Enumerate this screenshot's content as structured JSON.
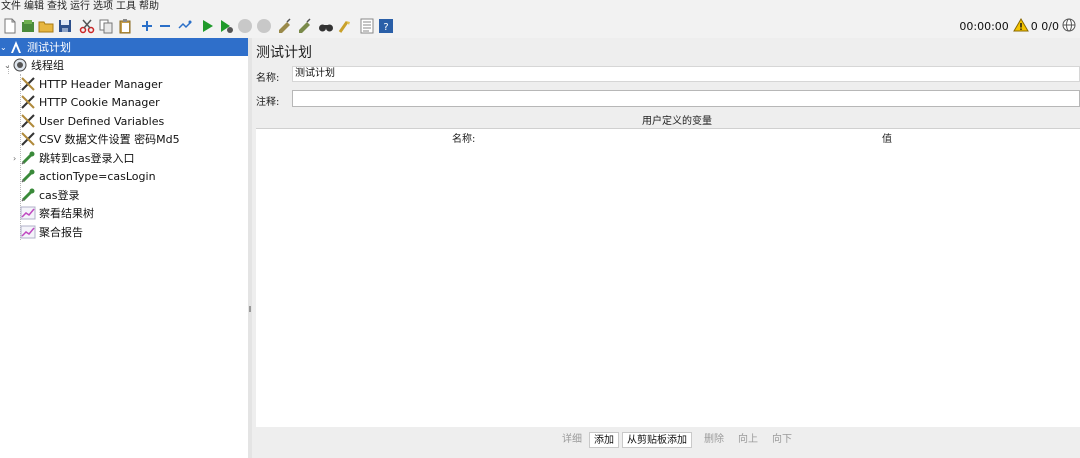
{
  "menu": [
    "文件",
    "编辑",
    "查找",
    "运行",
    "选项",
    "工具",
    "帮助"
  ],
  "toolbar": {
    "icons": [
      "new-icon",
      "templates-icon",
      "open-icon",
      "save-icon",
      "cut-icon",
      "copy-icon",
      "paste-icon",
      "expand-icon",
      "collapse-icon",
      "toggle-icon",
      "start-icon",
      "start-no-pause-icon",
      "stop-icon",
      "shutdown-icon",
      "clear-icon",
      "clear-all-icon",
      "search-icon",
      "reset-search-icon",
      "function-helper-icon",
      "help-icon"
    ]
  },
  "status": {
    "timer": "00:00:00",
    "count": "0 0/0"
  },
  "tree": {
    "items": [
      {
        "label": "测试计划",
        "icon": "test-plan-icon"
      },
      {
        "label": "线程组",
        "icon": "thread-group-icon"
      },
      {
        "label": "HTTP Header Manager",
        "icon": "config-element-icon"
      },
      {
        "label": "HTTP Cookie Manager",
        "icon": "config-element-icon"
      },
      {
        "label": "User Defined Variables",
        "icon": "config-element-icon"
      },
      {
        "label": "CSV 数据文件设置 密码Md5",
        "icon": "config-element-icon"
      },
      {
        "label": "跳转到cas登录入口",
        "icon": "sampler-pipette-icon"
      },
      {
        "label": "actionType=casLogin",
        "icon": "sampler-pipette-icon"
      },
      {
        "label": "cas登录",
        "icon": "sampler-pipette-icon"
      },
      {
        "label": "察看结果树",
        "icon": "listener-chart-icon"
      },
      {
        "label": "聚合报告",
        "icon": "listener-chart-icon"
      }
    ]
  },
  "panel": {
    "title": "测试计划",
    "name_label": "名称:",
    "name_value": "测试计划",
    "comment_label": "注释:",
    "comment_value": "",
    "vars_title": "用户定义的变量",
    "col_name": "名称:",
    "col_value": "值"
  },
  "buttons": {
    "detail": "详细",
    "add": "添加",
    "add_clipboard": "从剪贴板添加",
    "delete": "删除",
    "up": "向上",
    "down": "向下"
  },
  "colors": {
    "selection": "#2f6fca",
    "accent_warn": "#f5c400"
  }
}
